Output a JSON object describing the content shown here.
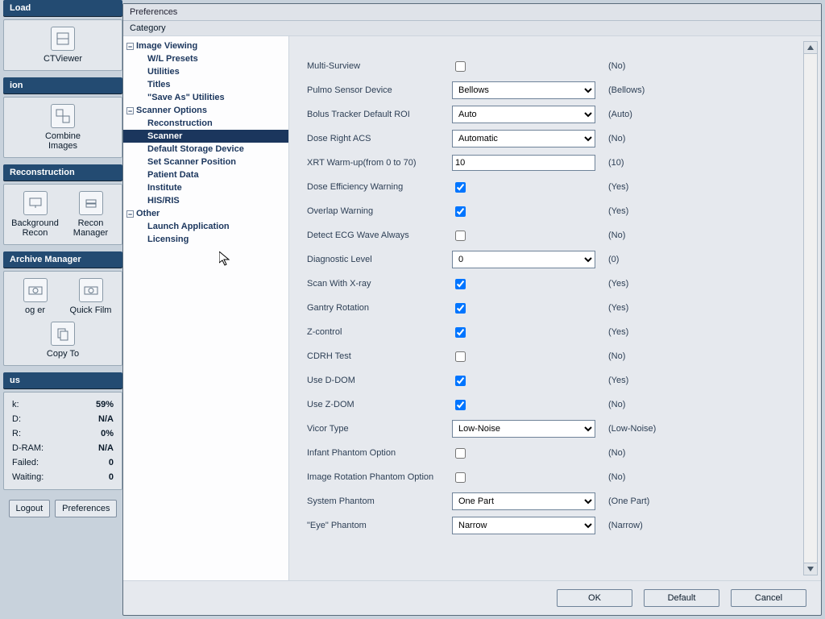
{
  "sidebar": {
    "sections": {
      "load": {
        "title": "Load",
        "tools": [
          {
            "label": "CTViewer",
            "icon": "cube-icon"
          }
        ]
      },
      "ion": {
        "title": "ion",
        "tools": [
          {
            "label": "Combine Images",
            "icon": "combine-icon"
          }
        ]
      },
      "recon": {
        "title": "Reconstruction",
        "tools": [
          {
            "label": "Background Recon",
            "icon": "monitor-icon"
          },
          {
            "label": "Recon Manager",
            "icon": "stack-icon"
          }
        ]
      },
      "archive": {
        "title": "Archive Manager",
        "tools": [
          {
            "label": "og er",
            "icon": "camera-icon"
          },
          {
            "label": "Quick Film",
            "icon": "camera-icon"
          },
          {
            "label": "Copy To",
            "icon": "copy-icon"
          }
        ]
      },
      "us": {
        "title": "us"
      }
    },
    "status": [
      {
        "label": "k:",
        "value": "59%"
      },
      {
        "label": "D:",
        "value": "N/A"
      },
      {
        "label": "R:",
        "value": "0%"
      },
      {
        "label": "D-RAM:",
        "value": "N/A"
      },
      {
        "label": "Failed:",
        "value": "0"
      },
      {
        "label": "Waiting:",
        "value": "0"
      }
    ],
    "bottom": {
      "logout": "Logout",
      "preferences": "Preferences"
    }
  },
  "dialog": {
    "title": "Preferences",
    "category_label": "Category",
    "tree": {
      "image_viewing": {
        "label": "Image Viewing",
        "children": [
          "W/L Presets",
          "Utilities",
          "Titles",
          "\"Save As\" Utilities"
        ]
      },
      "scanner_options": {
        "label": "Scanner Options",
        "children": [
          "Reconstruction",
          "Scanner",
          "Default Storage Device",
          "Set Scanner Position",
          "Patient Data",
          "Institute",
          "HIS/RIS"
        ]
      },
      "other": {
        "label": "Other",
        "children": [
          "Launch Application",
          "Licensing"
        ]
      }
    },
    "fields": [
      {
        "label": "Multi-Surview",
        "type": "check",
        "checked": false,
        "def": "(No)"
      },
      {
        "label": "Pulmo Sensor Device",
        "type": "select",
        "value": "Bellows",
        "def": "(Bellows)"
      },
      {
        "label": "Bolus Tracker Default ROI",
        "type": "select",
        "value": "Auto",
        "def": "(Auto)"
      },
      {
        "label": "Dose Right ACS",
        "type": "select",
        "value": "Automatic",
        "def": "(No)"
      },
      {
        "label": "XRT Warm-up(from 0 to 70)",
        "type": "text",
        "value": "10",
        "def": "(10)"
      },
      {
        "label": "Dose Efficiency Warning",
        "type": "check",
        "checked": true,
        "def": "(Yes)"
      },
      {
        "label": "Overlap Warning",
        "type": "check",
        "checked": true,
        "def": "(Yes)"
      },
      {
        "label": "Detect ECG Wave Always",
        "type": "check",
        "checked": false,
        "def": "(No)"
      },
      {
        "label": "Diagnostic Level",
        "type": "select",
        "value": "0",
        "def": "(0)"
      },
      {
        "label": "Scan With X-ray",
        "type": "check",
        "checked": true,
        "def": "(Yes)"
      },
      {
        "label": "Gantry Rotation",
        "type": "check",
        "checked": true,
        "def": "(Yes)"
      },
      {
        "label": "Z-control",
        "type": "check",
        "checked": true,
        "def": "(Yes)"
      },
      {
        "label": "CDRH Test",
        "type": "check",
        "checked": false,
        "def": "(No)"
      },
      {
        "label": "Use D-DOM",
        "type": "check",
        "checked": true,
        "def": "(Yes)"
      },
      {
        "label": "Use Z-DOM",
        "type": "check",
        "checked": true,
        "def": "(No)"
      },
      {
        "label": "Vicor Type",
        "type": "select",
        "value": "Low-Noise",
        "def": "(Low-Noise)"
      },
      {
        "label": "Infant Phantom Option",
        "type": "check",
        "checked": false,
        "def": "(No)"
      },
      {
        "label": "Image Rotation Phantom Option",
        "type": "check",
        "checked": false,
        "def": "(No)"
      },
      {
        "label": "System Phantom",
        "type": "select",
        "value": "One Part",
        "def": "(One Part)"
      },
      {
        "label": "\"Eye\" Phantom",
        "type": "select",
        "value": "Narrow",
        "def": "(Narrow)"
      }
    ],
    "buttons": {
      "ok": "OK",
      "default": "Default",
      "cancel": "Cancel"
    }
  }
}
